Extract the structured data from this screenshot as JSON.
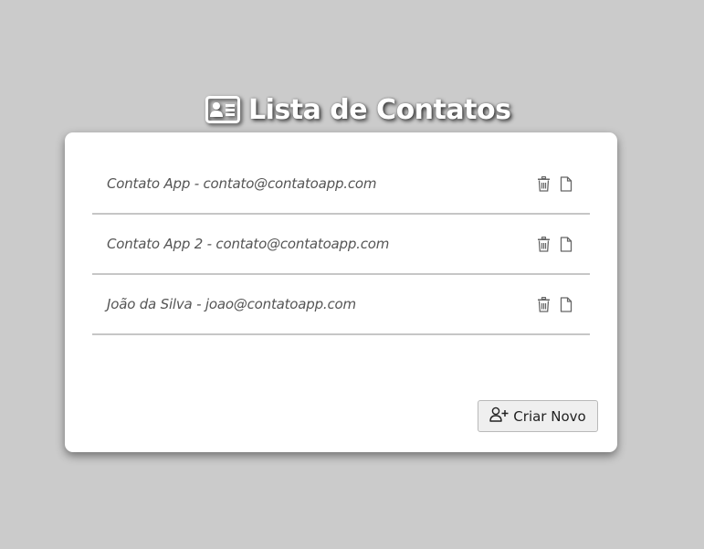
{
  "header": {
    "title": "Lista de Contatos",
    "icon": "contact-card-icon"
  },
  "contacts": [
    {
      "text": "Contato App - contato@contatoapp.com",
      "actions": [
        "trash-icon",
        "file-icon"
      ]
    },
    {
      "text": "Contato App 2 - contato@contatoapp.com",
      "actions": [
        "trash-icon",
        "file-icon"
      ]
    },
    {
      "text": "João da Silva - joao@contatoapp.com",
      "actions": [
        "trash-icon",
        "file-icon"
      ]
    }
  ],
  "create_button": {
    "label": "Criar Novo",
    "icon": "person-plus-icon"
  },
  "colors": {
    "background": "#cbcbcb",
    "card": "#ffffff",
    "divider": "#c6c6c6",
    "text": "#555555",
    "icon": "#666666"
  }
}
